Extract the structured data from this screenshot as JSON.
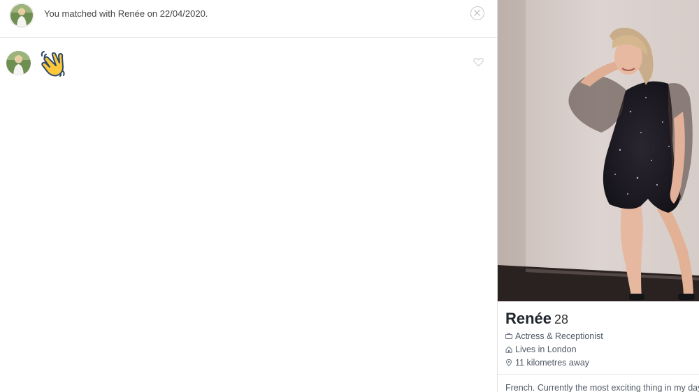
{
  "header": {
    "match_text": "You matched with Renée on 22/04/2020.",
    "close_icon": "close-circle-icon"
  },
  "messages": [
    {
      "sender": "Renée",
      "content": "👋",
      "content_icon": "waving-hand-emoji",
      "like_icon": "heart-outline-icon"
    }
  ],
  "profile": {
    "name": "Renée",
    "age": "28",
    "job": "Actress & Receptionist",
    "lives": "Lives in London",
    "distance": "11 kilometres away",
    "bio": "French. Currently the most exciting thing in my day",
    "job_icon": "briefcase-icon",
    "home_icon": "house-icon",
    "distance_icon": "location-pin-icon"
  },
  "colors": {
    "text": "#444444",
    "name": "#21262e",
    "muted": "#505965",
    "border": "#e4e4e4"
  }
}
